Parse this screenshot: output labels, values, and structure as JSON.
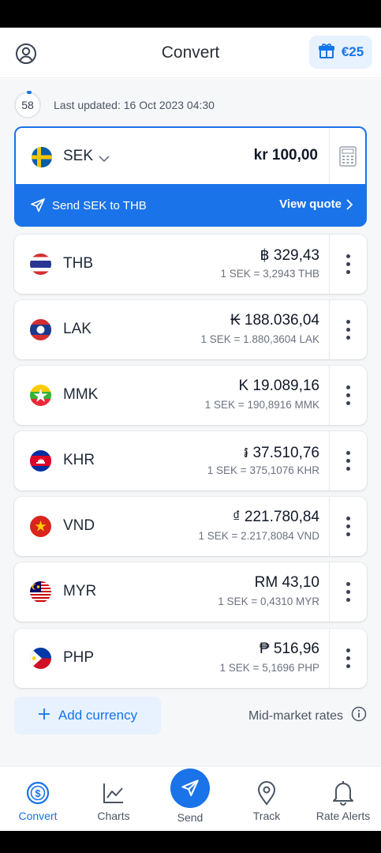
{
  "header": {
    "title": "Convert",
    "reward_label": "€25"
  },
  "update": {
    "seconds": "58",
    "text": "Last updated: 16 Oct 2023 04:30"
  },
  "base": {
    "code": "SEK",
    "amount": "kr 100,00",
    "send_label": "Send SEK to THB",
    "view_quote": "View quote"
  },
  "rows": [
    {
      "code": "THB",
      "amount": "฿ 329,43",
      "rate": "1 SEK = 3,2943 THB"
    },
    {
      "code": "LAK",
      "amount": "₭ 188.036,04",
      "rate": "1 SEK = 1.880,3604 LAK"
    },
    {
      "code": "MMK",
      "amount": "K 19.089,16",
      "rate": "1 SEK = 190,8916 MMK"
    },
    {
      "code": "KHR",
      "amount": "៛ 37.510,76",
      "rate": "1 SEK = 375,1076 KHR"
    },
    {
      "code": "VND",
      "amount": "₫ 221.780,84",
      "rate": "1 SEK = 2.217,8084 VND"
    },
    {
      "code": "MYR",
      "amount": "RM 43,10",
      "rate": "1 SEK = 0,4310 MYR"
    },
    {
      "code": "PHP",
      "amount": "₱ 516,96",
      "rate": "1 SEK = 5,1696 PHP"
    }
  ],
  "footer": {
    "add_currency": "Add currency",
    "mid_market": "Mid-market rates"
  },
  "tabs": [
    {
      "label": "Convert"
    },
    {
      "label": "Charts"
    },
    {
      "label": "Send"
    },
    {
      "label": "Track"
    },
    {
      "label": "Rate Alerts"
    }
  ],
  "colors": {
    "accent": "#1a73e8",
    "accent_light": "#e8f1fe"
  }
}
